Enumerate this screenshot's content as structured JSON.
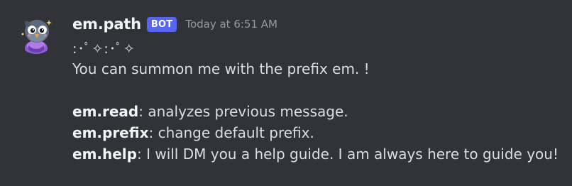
{
  "message": {
    "author": {
      "name": "em.path",
      "badge": "BOT",
      "avatar_icon": "pigeon-avatar-icon"
    },
    "timestamp": "Today at 6:51 AM",
    "lines": {
      "sparkles": ":･ﾟ✧:･ﾟ✧",
      "intro": "You can summon me with the prefix em. !",
      "commands": [
        {
          "name": "em.read",
          "desc": ": analyzes previous message."
        },
        {
          "name": "em.prefix",
          "desc": ": change default prefix."
        },
        {
          "name": "em.help",
          "desc": ": I will DM you a help guide. I am always here to guide you!"
        }
      ]
    }
  },
  "colors": {
    "background": "#313338",
    "username": "#f2f3f5",
    "text": "#dbdee1",
    "timestamp": "#949ba4",
    "bot_badge": "#5865f2"
  }
}
